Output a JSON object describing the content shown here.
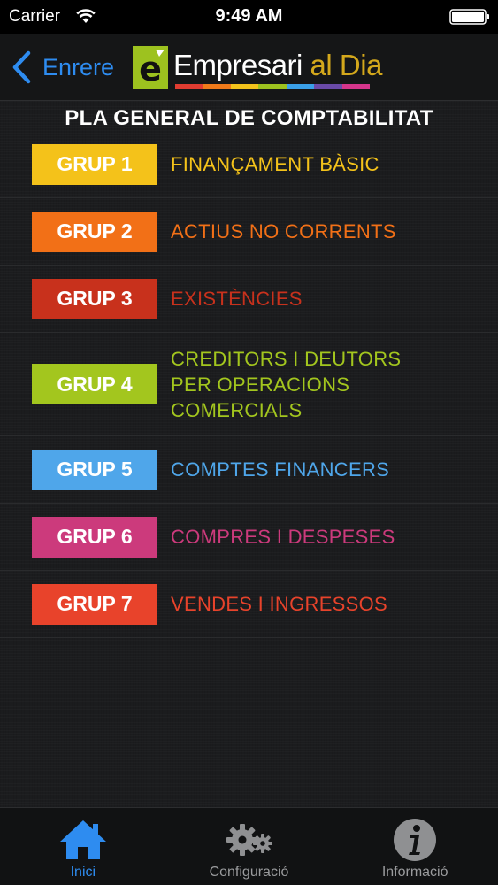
{
  "status": {
    "carrier": "Carrier",
    "time": "9:49 AM"
  },
  "nav": {
    "back_label": "Enrere",
    "logo_text": "Empresari al Dia",
    "logo_text_main": "Empresari",
    "logo_text_accent": "al Dia",
    "logo_colors": [
      "#e03c31",
      "#f07a1a",
      "#f2c21b",
      "#9dc21f",
      "#3aa0e8",
      "#6a4aa8",
      "#d6358b"
    ]
  },
  "page_title": "PLA GENERAL DE COMPTABILITAT",
  "groups": [
    {
      "badge": "GRUP 1",
      "label_lines": [
        "FINANÇAMENT BÀSIC"
      ],
      "color": "#f4c21a"
    },
    {
      "badge": "GRUP 2",
      "label_lines": [
        "ACTIUS NO CORRENTS"
      ],
      "color": "#f27017"
    },
    {
      "badge": "GRUP 3",
      "label_lines": [
        "EXISTÈNCIES"
      ],
      "color": "#c8311c"
    },
    {
      "badge": "GRUP 4",
      "label_lines": [
        "CREDITORS I DEUTORS",
        "PER OPERACIONS",
        "COMERCIALS"
      ],
      "color": "#a3c61e"
    },
    {
      "badge": "GRUP 5",
      "label_lines": [
        "COMPTES FINANCERS"
      ],
      "color": "#4fa6ea"
    },
    {
      "badge": "GRUP 6",
      "label_lines": [
        "COMPRES I DESPESES"
      ],
      "color": "#cc3a7c"
    },
    {
      "badge": "GRUP 7",
      "label_lines": [
        "VENDES I INGRESSOS"
      ],
      "color": "#e8432b"
    }
  ],
  "tabs": [
    {
      "label": "Inici",
      "icon": "home-icon",
      "active": true
    },
    {
      "label": "Configuració",
      "icon": "gears-icon",
      "active": false
    },
    {
      "label": "Informació",
      "icon": "info-icon",
      "active": false
    }
  ],
  "colors": {
    "accent": "#2e8cf0",
    "background": "#1b1c1e",
    "tab_inactive": "#9a9b9d"
  }
}
